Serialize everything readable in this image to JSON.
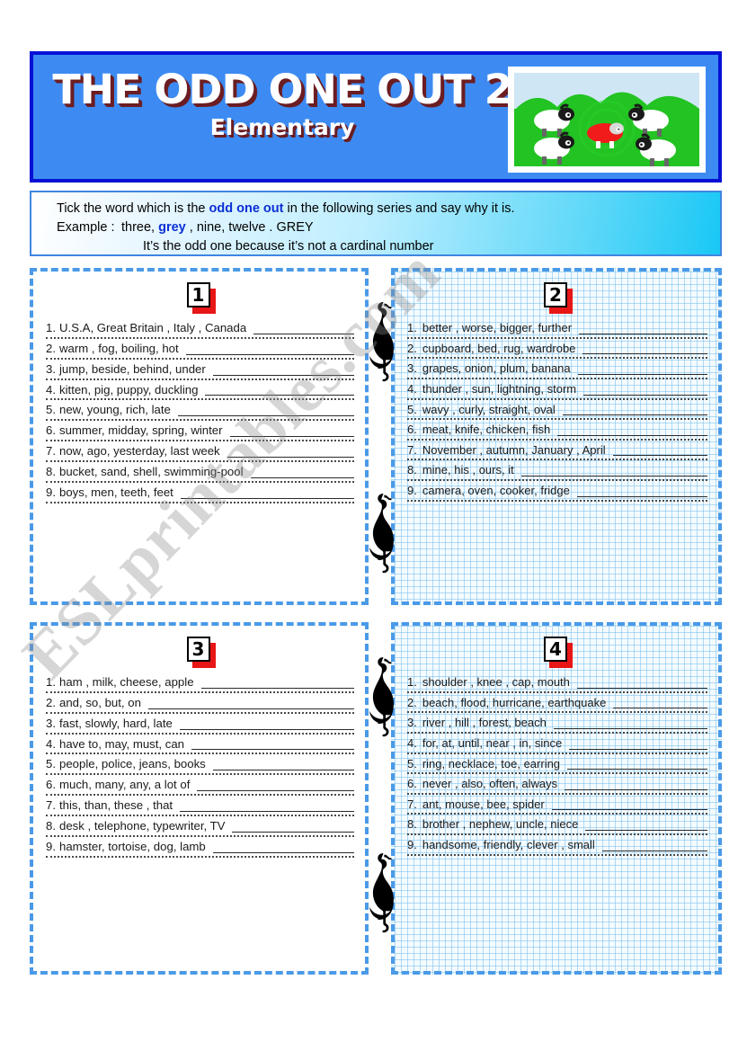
{
  "header": {
    "title": "THE ODD ONE OUT 2",
    "subtitle": "Elementary",
    "picture_alt": "four-white-sheep-and-one-red-sheep-on-green-hills"
  },
  "instructions": {
    "line1_part1": "Tick the word which is  the ",
    "line1_bold": "odd one out",
    "line1_part2": " in the following  series and say why it is.",
    "example_label": "Example :",
    "example_part1": "three, ",
    "example_bold": "grey",
    "example_part2": " , nine, twelve  .  GREY",
    "example_reason": "It’s the odd one because it’s not a cardinal number"
  },
  "boxes": [
    {
      "number": "1",
      "style": "plain",
      "items": [
        {
          "num": "1.",
          "words": "U.S.A, Great Britain , Italy , Canada"
        },
        {
          "num": "2.",
          "words": "warm , fog, boiling, hot"
        },
        {
          "num": "3.",
          "words": "jump, beside, behind, under"
        },
        {
          "num": "4.",
          "words": "kitten, pig, puppy, duckling"
        },
        {
          "num": "5.",
          "words": "new, young, rich, late"
        },
        {
          "num": "6.",
          "words": "summer, midday, spring, winter"
        },
        {
          "num": "7.",
          "words": "now, ago, yesterday, last week"
        },
        {
          "num": "8.",
          "words": "bucket, sand, shell, swimming-pool"
        },
        {
          "num": "9.",
          "words": "boys, men, teeth, feet"
        }
      ]
    },
    {
      "number": "2",
      "style": "grid",
      "items": [
        {
          "num": "1.",
          "words": "better , worse, bigger, further"
        },
        {
          "num": "2.",
          "words": "cupboard, bed, rug, wardrobe"
        },
        {
          "num": "3.",
          "words": "grapes, onion, plum, banana"
        },
        {
          "num": "4.",
          "words": "thunder , sun, lightning, storm"
        },
        {
          "num": "5.",
          "words": "wavy , curly, straight, oval"
        },
        {
          "num": "6.",
          "words": "meat, knife, chicken, fish"
        },
        {
          "num": "7.",
          "words": "November , autumn, January , April"
        },
        {
          "num": "8.",
          "words": "mine, his , ours, it"
        },
        {
          "num": "9.",
          "words": "camera, oven, cooker, fridge"
        }
      ]
    },
    {
      "number": "3",
      "style": "plain",
      "items": [
        {
          "num": "1.",
          "words": "ham , milk, cheese, apple"
        },
        {
          "num": "2.",
          "words": "and, so, but, on"
        },
        {
          "num": "3.",
          "words": "fast, slowly, hard, late"
        },
        {
          "num": "4.",
          "words": "have to, may, must, can"
        },
        {
          "num": "5.",
          "words": "people, police, jeans, books"
        },
        {
          "num": "6.",
          "words": "much, many, any, a lot of"
        },
        {
          "num": "7.",
          "words": "this, than, these , that"
        },
        {
          "num": "8.",
          "words": "desk , telephone, typewriter, TV"
        },
        {
          "num": "9.",
          "words": "hamster, tortoise, dog, lamb"
        }
      ]
    },
    {
      "number": "4",
      "style": "grid",
      "items": [
        {
          "num": "1.",
          "words": "shoulder , knee , cap, mouth"
        },
        {
          "num": "2.",
          "words": "beach, flood, hurricane, earthquake"
        },
        {
          "num": "3.",
          "words": "river , hill , forest, beach"
        },
        {
          "num": "4.",
          "words": "for, at, until,  near , in, since"
        },
        {
          "num": "5.",
          "words": "ring, necklace, toe, earring"
        },
        {
          "num": "6.",
          "words": "never , also, often, always"
        },
        {
          "num": "7.",
          "words": "ant, mouse, bee, spider"
        },
        {
          "num": "8.",
          "words": "brother , nephew, uncle, niece"
        },
        {
          "num": "9.",
          "words": "handsome, friendly, clever , small"
        }
      ]
    }
  ],
  "watermark": {
    "text": "ESLprintables.com"
  },
  "colors": {
    "header_fill": "#3d8bf2",
    "header_border": "#0611d6",
    "title_text": "#ffffff",
    "title_shadow": "#6b1d22",
    "instruction_accent": "#0a2fd4",
    "box_border": "#4a9ae8",
    "badge_shadow": "#e81616"
  }
}
